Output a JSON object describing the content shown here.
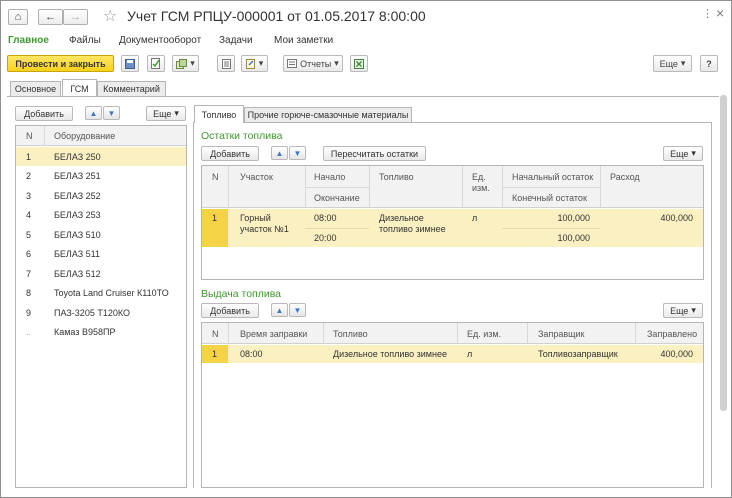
{
  "window": {
    "title": "Учет ГСМ РПЦУ-000001 от 01.05.2017 8:00:00",
    "controls": [
      "⋮",
      "×"
    ]
  },
  "nav": {
    "home_glyph": "⌂",
    "back_glyph": "←",
    "forward_glyph": "→",
    "star_glyph": "☆"
  },
  "menu": {
    "items": [
      "Главное",
      "Файлы",
      "Документооборот",
      "Задачи",
      "Мои заметки"
    ]
  },
  "toolbar": {
    "primary_label": "Провести и закрыть",
    "reports_label": "Отчеты",
    "more_label": "Еще",
    "help_label": "?"
  },
  "main_tabs": [
    "Основное",
    "ГСМ",
    "Комментарий"
  ],
  "left_panel": {
    "add_label": "Добавить",
    "more_label": "Еще",
    "columns": [
      "N",
      "Оборудование"
    ],
    "rows": [
      {
        "n": "1",
        "name": "БЕЛАЗ 250"
      },
      {
        "n": "2",
        "name": "БЕЛАЗ 251"
      },
      {
        "n": "3",
        "name": "БЕЛАЗ 252"
      },
      {
        "n": "4",
        "name": "БЕЛАЗ 253"
      },
      {
        "n": "5",
        "name": "БЕЛАЗ 510"
      },
      {
        "n": "6",
        "name": "БЕЛАЗ 511"
      },
      {
        "n": "7",
        "name": "БЕЛАЗ 512"
      },
      {
        "n": "8",
        "name": "Toyota Land Cruiser К110ТО"
      },
      {
        "n": "9",
        "name": "ПАЗ-3205 Т120КО"
      },
      {
        "n": "..",
        "name": "Камаз В958ПР"
      }
    ]
  },
  "inner_tabs": [
    "Топливо",
    "Прочие горюче-смазочные материалы"
  ],
  "fuel_balance": {
    "title": "Остатки топлива",
    "add_label": "Добавить",
    "recalc_label": "Пересчитать остатки",
    "more_label": "Еще",
    "columns": {
      "n": "N",
      "area": "Участок",
      "start": "Начало",
      "end": "Окончание",
      "fuel": "Топливо",
      "unit": "Ед. изм.",
      "start_balance": "Начальный остаток",
      "end_balance": "Конечный остаток",
      "expense": "Расход"
    },
    "row": {
      "n": "1",
      "area": "Горный участок №1",
      "start": "08:00",
      "end": "20:00",
      "fuel": "Дизельное топливо зимнее",
      "unit": "л",
      "start_balance": "100,000",
      "end_balance": "100,000",
      "expense": "400,000"
    }
  },
  "fuel_issue": {
    "title": "Выдача топлива",
    "add_label": "Добавить",
    "more_label": "Еще",
    "columns": [
      "N",
      "Время заправки",
      "Топливо",
      "Ед. изм.",
      "Заправщик",
      "Заправлено"
    ],
    "row": {
      "n": "1",
      "time": "08:00",
      "fuel": "Дизельное топливо зимнее",
      "unit": "л",
      "refueler": "Топливозаправщик",
      "amount": "400,000"
    }
  },
  "colors": {
    "accent_green": "#3d9a2c",
    "primary_yellow": "#f7d11c",
    "selection": "#fbf0c1"
  }
}
